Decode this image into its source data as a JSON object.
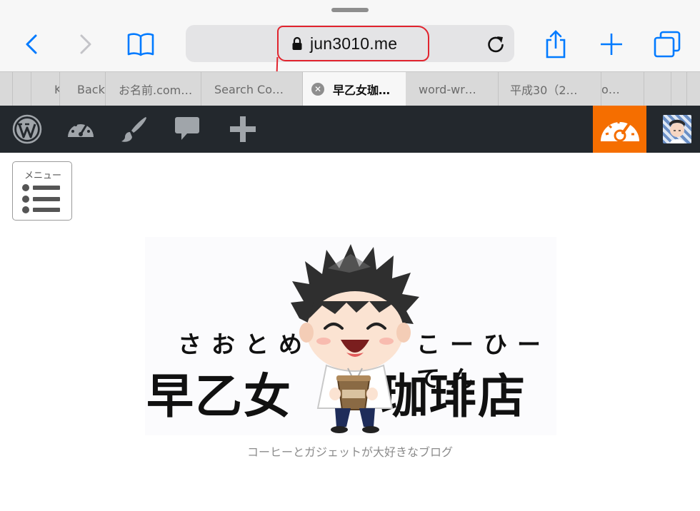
{
  "browser": {
    "url": "jun3010.me",
    "tabs": [
      {
        "label": "K",
        "active": false
      },
      {
        "label": "Back",
        "active": false
      },
      {
        "label": "お名前.com…",
        "active": false
      },
      {
        "label": "Search Co…",
        "active": false
      },
      {
        "label": "早乙女珈…",
        "active": true
      },
      {
        "label": "word-wr…",
        "active": false
      },
      {
        "label": "平成30（2…",
        "active": false
      },
      {
        "label": "o…",
        "active": false
      }
    ],
    "accent": "#007aff",
    "annotation_color": "#e1242e"
  },
  "adminbar": {
    "icons": [
      "wordpress-icon",
      "dashboard-icon",
      "customize-brush-icon",
      "comments-icon",
      "add-new-icon",
      "performance-gauge-icon",
      "user-avatar"
    ],
    "background": "#23282d",
    "highlight": "#f56e00"
  },
  "page": {
    "menu_label": "メニュー",
    "logo": {
      "ruby_left": "さおとめ",
      "ruby_right": "こーひーてん",
      "title_left": "早乙女",
      "title_right": "珈琲店"
    },
    "tagline": "コーヒーとガジェットが大好きなブログ"
  }
}
